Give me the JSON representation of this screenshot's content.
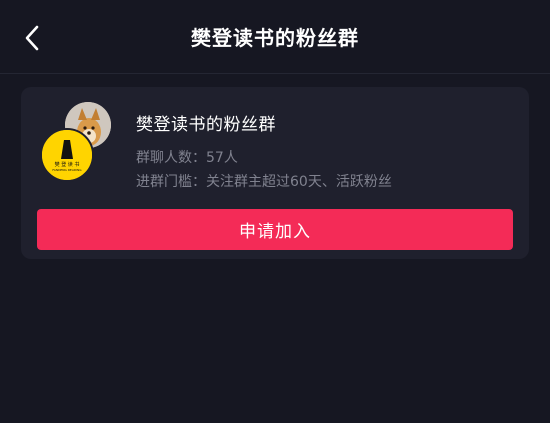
{
  "nav": {
    "title": "樊登读书的粉丝群"
  },
  "group": {
    "name": "樊登读书的粉丝群",
    "member_count_label": "群聊人数：",
    "member_count": "57人",
    "threshold_label": "进群门槛：",
    "threshold": "关注群主超过60天、活跃粉丝",
    "front_avatar_text": "樊 登 读 书",
    "front_avatar_subtext": "FANDENG READING"
  },
  "actions": {
    "join_label": "申请加入"
  },
  "colors": {
    "background": "#161722",
    "card": "#1f202d",
    "accent": "#f42b57",
    "logo_yellow": "#ffd400"
  },
  "icons": {
    "back": "chevron-left-icon"
  }
}
